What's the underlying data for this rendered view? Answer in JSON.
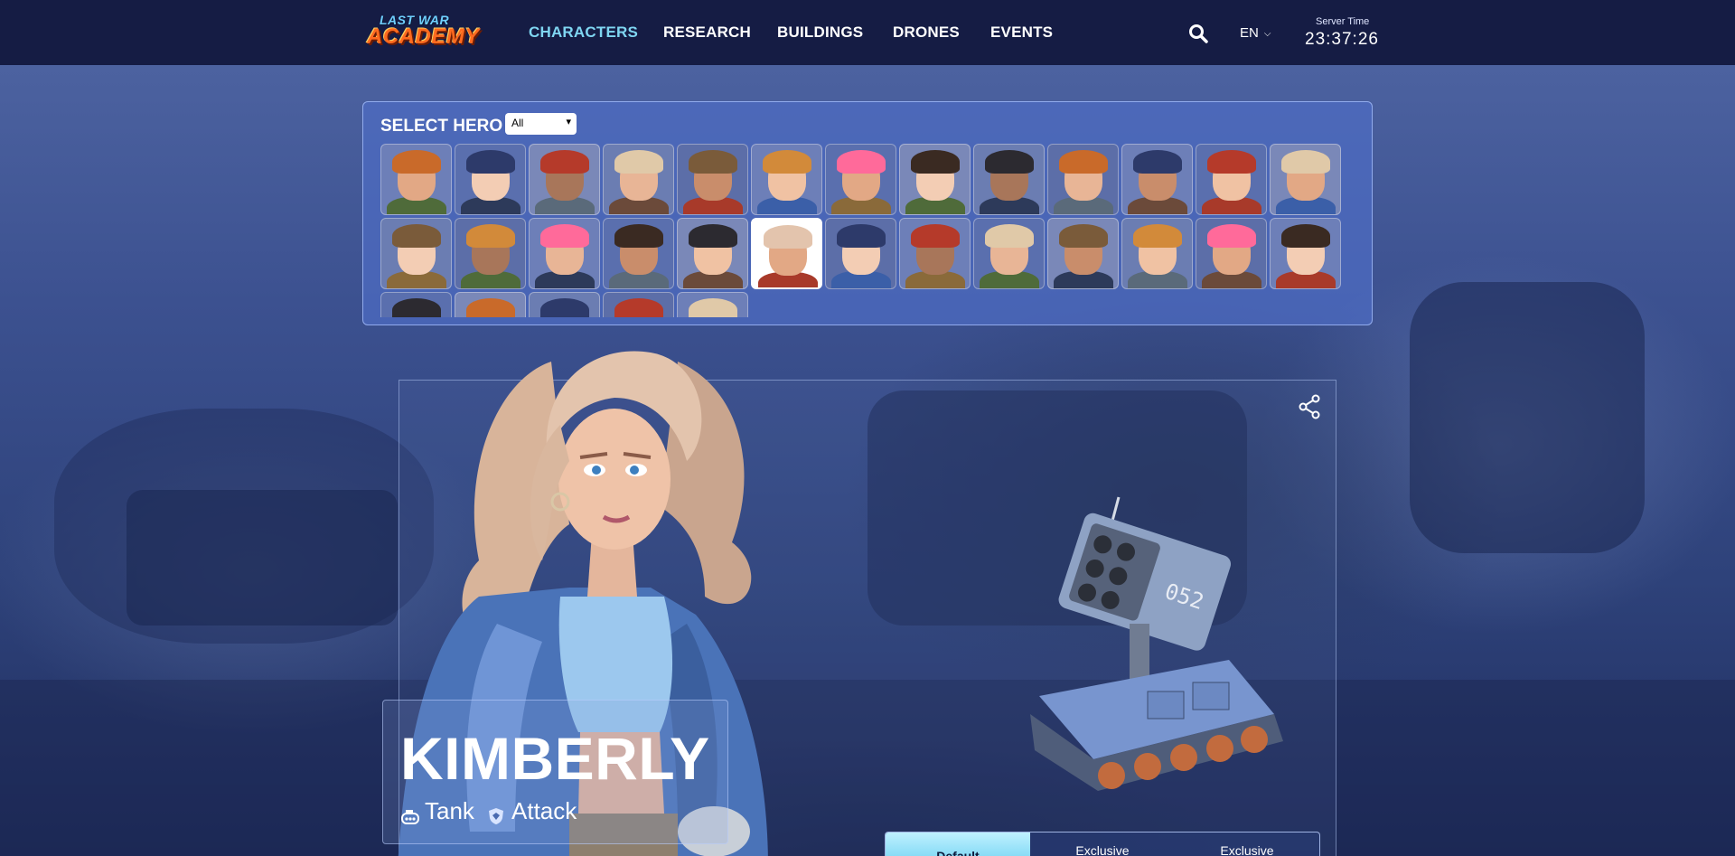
{
  "nav": {
    "logo_top": "LAST WAR",
    "logo_bottom": "ACADEMY",
    "links": [
      "CHARACTERS",
      "RESEARCH",
      "BUILDINGS",
      "DRONES",
      "EVENTS"
    ],
    "active_index": 0,
    "language": "EN",
    "server_time_label": "Server Time",
    "server_time": "23:37:26",
    "search_icon": "search-icon"
  },
  "selector": {
    "title": "SELECT HERO",
    "filter_value": "All",
    "selected_index": 18,
    "portrait_count": 31
  },
  "hero": {
    "name": "KIMBERLY",
    "type": "Tank",
    "role": "Attack",
    "type_icon": "tank-icon",
    "role_icon": "shield-icon"
  },
  "skins": {
    "tabs": [
      "Default",
      "Exclusive",
      "Exclusive"
    ],
    "active_index": 0
  },
  "colors": {
    "nav_bg": "#151c44",
    "accent": "#7fd6f2",
    "panel": "#4e6cc4"
  }
}
